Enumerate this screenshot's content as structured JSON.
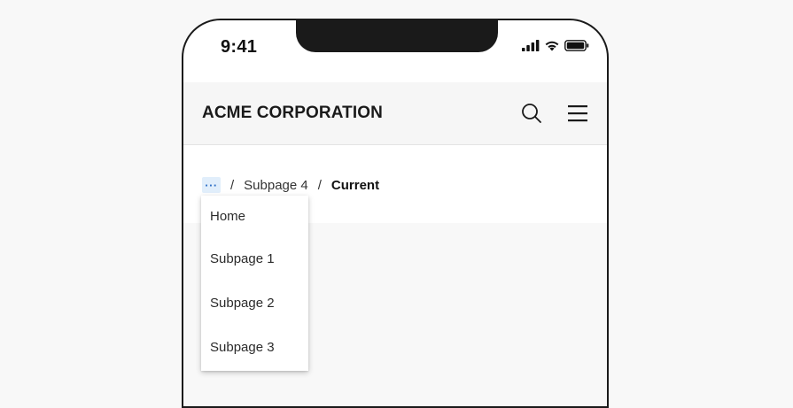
{
  "status_bar": {
    "time": "9:41",
    "icons": [
      "signal-icon",
      "wifi-icon",
      "battery-icon"
    ]
  },
  "header": {
    "title": "ACME CORPORATION",
    "icons": [
      "search-icon",
      "hamburger-menu-icon"
    ]
  },
  "breadcrumb": {
    "overflow_label": "···",
    "separator": "/",
    "items": [
      {
        "label": "Subpage 4"
      },
      {
        "label": "Current"
      }
    ]
  },
  "overflow_menu": {
    "items": [
      {
        "label": "Home"
      },
      {
        "label": "Subpage 1"
      },
      {
        "label": "Subpage 2"
      },
      {
        "label": "Subpage 3"
      }
    ]
  },
  "colors": {
    "background": "#f8f8f8",
    "overflow_button_bg": "#e1eefb",
    "overflow_button_fg": "#2d6ec6",
    "text": "#333333"
  }
}
